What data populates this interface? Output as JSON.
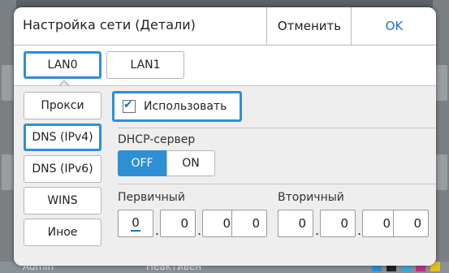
{
  "dialog": {
    "title": "Настройка сети (Детали)",
    "cancel_label": "Отменить",
    "ok_label": "OK"
  },
  "lan_tabs": [
    {
      "label": "LAN0",
      "active": true
    },
    {
      "label": "LAN1",
      "active": false
    }
  ],
  "sidebar": {
    "items": [
      {
        "label": "Прокси",
        "active": false
      },
      {
        "label": "DNS (IPv4)",
        "active": true
      },
      {
        "label": "DNS (IPv6)",
        "active": false
      },
      {
        "label": "WINS",
        "active": false
      },
      {
        "label": "Иное",
        "active": false
      }
    ]
  },
  "use": {
    "label": "Использовать",
    "checked": true
  },
  "dhcp": {
    "label": "DHCP-сервер",
    "off_label": "OFF",
    "on_label": "ON",
    "selected": "OFF"
  },
  "primary": {
    "label": "Первичный",
    "octets": [
      "0",
      "0",
      "0",
      "0"
    ]
  },
  "secondary": {
    "label": "Вторичный",
    "octets": [
      "0",
      "0",
      "0",
      "0"
    ]
  },
  "background": {
    "user": "Admin",
    "status": "Неактивен"
  },
  "colors": {
    "accent": "#2d8fd4",
    "ok_text": "#1a73c7",
    "panel_bg": "#eeeeee"
  }
}
